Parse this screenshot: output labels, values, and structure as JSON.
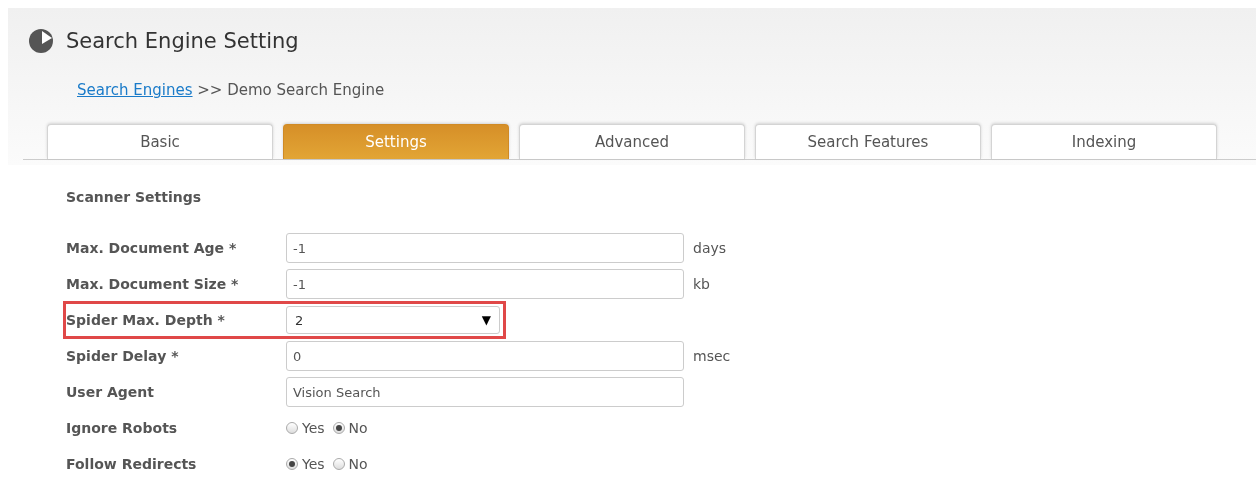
{
  "page": {
    "title": "Search Engine Setting",
    "breadcrumb": {
      "link": "Search Engines",
      "separator": ">>",
      "current": "Demo Search Engine"
    }
  },
  "tabs": [
    {
      "label": "Basic",
      "selected": false
    },
    {
      "label": "Settings",
      "selected": true
    },
    {
      "label": "Advanced",
      "selected": false
    },
    {
      "label": "Search Features",
      "selected": false
    },
    {
      "label": "Indexing",
      "selected": false
    }
  ],
  "section": {
    "title": "Scanner Settings"
  },
  "fields": [
    {
      "kind": "text",
      "label": "Max. Document Age *",
      "value": "-1",
      "unit": "days",
      "highlighted": false
    },
    {
      "kind": "text",
      "label": "Max. Document Size *",
      "value": "-1",
      "unit": "kb",
      "highlighted": false
    },
    {
      "kind": "select",
      "label": "Spider Max. Depth *",
      "value": "2",
      "caret": "▼",
      "highlighted": true
    },
    {
      "kind": "text",
      "label": "Spider Delay *",
      "value": "0",
      "unit": "msec",
      "highlighted": false
    },
    {
      "kind": "text",
      "label": "User Agent",
      "value": "Vision Search",
      "highlighted": false
    },
    {
      "kind": "radio",
      "label": "Ignore Robots",
      "highlighted": false,
      "options": [
        {
          "label": "Yes",
          "selected": false
        },
        {
          "label": "No",
          "selected": true
        }
      ]
    },
    {
      "kind": "radio",
      "label": "Follow Redirects",
      "highlighted": false,
      "options": [
        {
          "label": "Yes",
          "selected": true
        },
        {
          "label": "No",
          "selected": false
        }
      ]
    }
  ]
}
